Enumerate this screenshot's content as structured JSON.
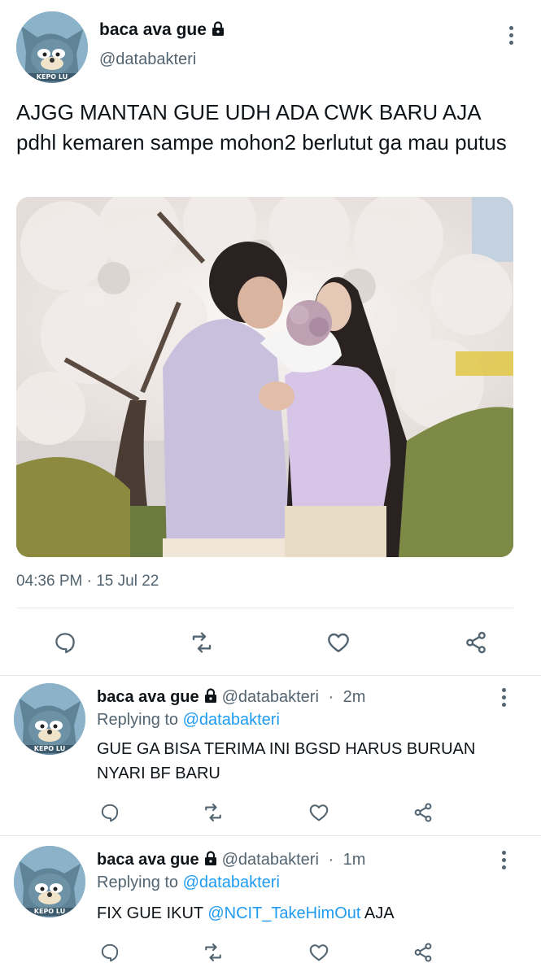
{
  "tweet": {
    "display_name": "baca ava gue",
    "handle": "@databakteri",
    "avatar_caption": "KEPO LU",
    "text": "AJGG MANTAN GUE UDH ADA CWK BARU AJA pdhl kemaren sampe mohon2 berlutut ga mau putus",
    "timestamp": "04:36 PM · 15 Jul 22"
  },
  "replies": [
    {
      "display_name": "baca ava gue",
      "handle": "@databakteri",
      "time": "2m",
      "avatar_caption": "KEPO LU",
      "replying_prefix": "Replying to",
      "replying_handle": "@databakteri",
      "text": "GUE GA BISA TERIMA INI BGSD HARUS BURUAN NYARI BF BARU"
    },
    {
      "display_name": "baca ava gue",
      "handle": "@databakteri",
      "time": "1m",
      "avatar_caption": "KEPO LU",
      "replying_prefix": "Replying to",
      "replying_handle": "@databakteri",
      "text_before": "FIX GUE IKUT ",
      "mention": "@NCIT_TakeHimOut",
      "text_after": " AJA"
    }
  ],
  "separator": " · ",
  "icons": [
    "lock-icon",
    "more-options-icon",
    "reply-icon",
    "retweet-icon",
    "like-icon",
    "share-icon"
  ],
  "colors": {
    "link": "#1d9bf0",
    "secondary_text": "#536471",
    "divider": "#e5e8eb"
  }
}
